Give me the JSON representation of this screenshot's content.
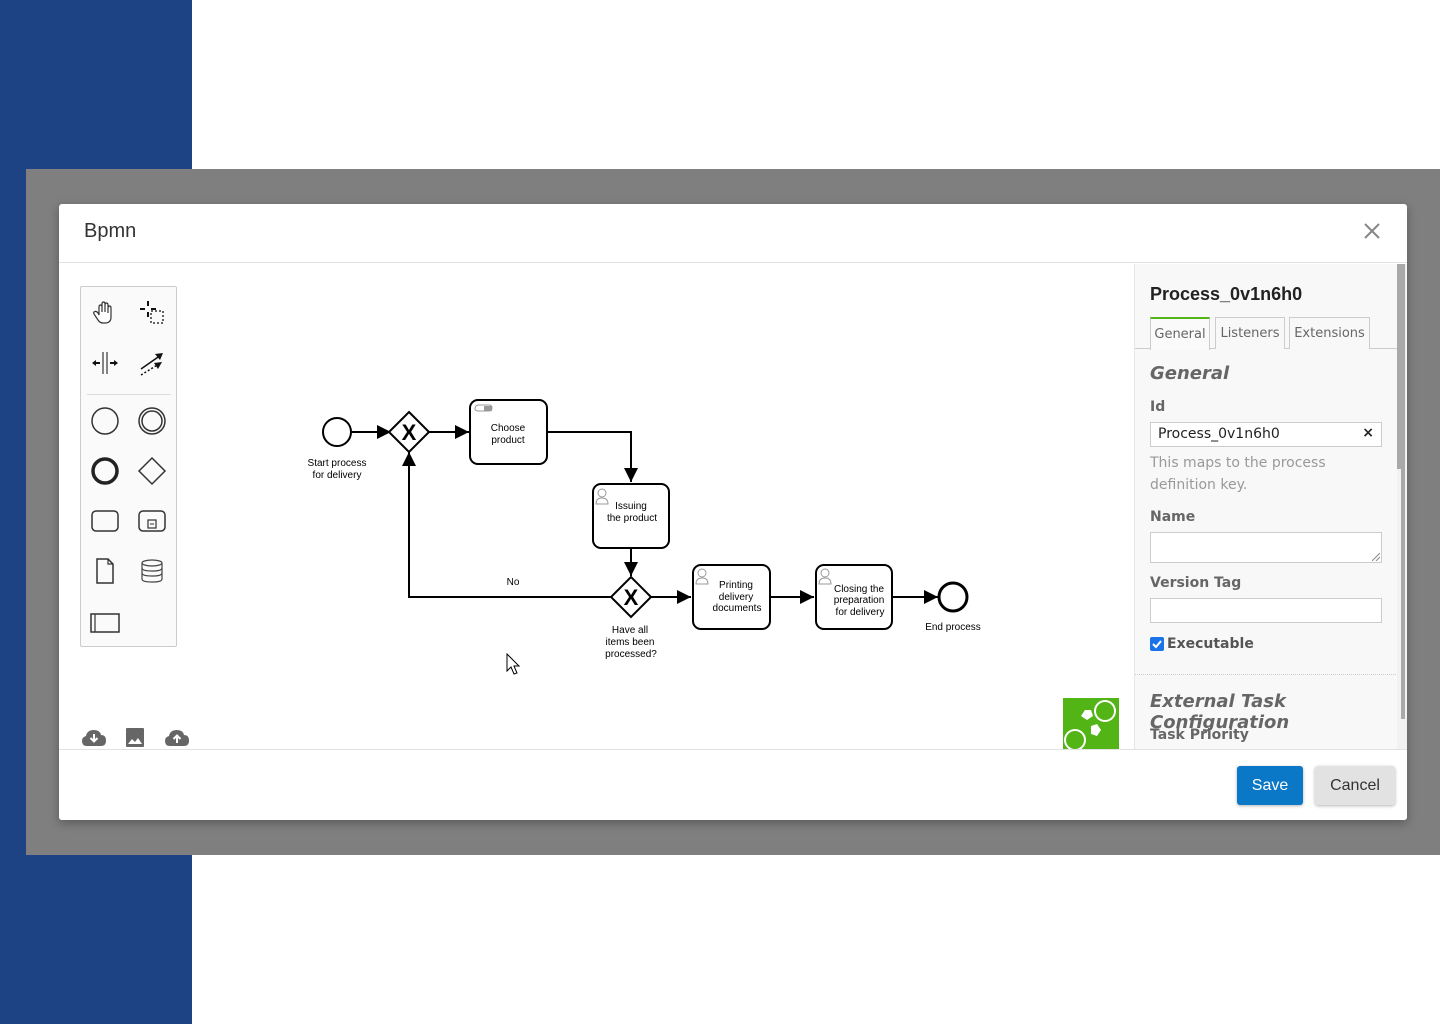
{
  "modal": {
    "title": "Bpmn",
    "close_icon": "close-icon"
  },
  "palette": {
    "tools": [
      {
        "name": "hand-tool",
        "icon": "hand-icon"
      },
      {
        "name": "lasso-tool",
        "icon": "lasso-icon"
      },
      {
        "name": "space-tool",
        "icon": "space-icon"
      },
      {
        "name": "global-connect-tool",
        "icon": "connect-icon"
      },
      {
        "name": "create-start-event",
        "icon": "start-event-icon"
      },
      {
        "name": "create-intermediate-event",
        "icon": "intermediate-event-icon"
      },
      {
        "name": "create-end-event",
        "icon": "end-event-icon"
      },
      {
        "name": "create-gateway",
        "icon": "gateway-icon"
      },
      {
        "name": "create-task",
        "icon": "task-icon"
      },
      {
        "name": "create-subprocess",
        "icon": "subprocess-icon"
      },
      {
        "name": "create-data-object",
        "icon": "data-object-icon"
      },
      {
        "name": "create-data-store",
        "icon": "data-store-icon"
      },
      {
        "name": "create-pool",
        "icon": "pool-icon"
      }
    ]
  },
  "diagram": {
    "start_event": {
      "label_lines": [
        "Start process",
        "for delivery"
      ]
    },
    "gateway_1": {
      "marker": "X"
    },
    "task_choose": {
      "label_lines": [
        "Choose",
        "product"
      ],
      "type": "manual-task"
    },
    "task_issuing": {
      "label_lines": [
        "Issuing",
        "the product"
      ],
      "type": "user-task"
    },
    "gateway_2": {
      "marker": "X",
      "label_lines": [
        "Have all",
        "items been",
        "processed?"
      ]
    },
    "flow_no": {
      "label": "No"
    },
    "task_printing": {
      "label_lines": [
        "Printing",
        "delivery",
        "documents"
      ],
      "type": "user-task"
    },
    "task_closing": {
      "label_lines": [
        "Closing the",
        "preparation",
        "for delivery"
      ],
      "type": "user-task"
    },
    "end_event": {
      "label_lines": [
        "End process"
      ]
    }
  },
  "canvas_actions": [
    {
      "name": "download-diagram-button",
      "icon": "cloud-download-icon"
    },
    {
      "name": "export-image-button",
      "icon": "image-icon"
    },
    {
      "name": "upload-diagram-button",
      "icon": "cloud-upload-icon"
    }
  ],
  "properties": {
    "title": "Process_0v1n6h0",
    "tabs": [
      {
        "label": "General",
        "active": true
      },
      {
        "label": "Listeners",
        "active": false
      },
      {
        "label": "Extensions",
        "active": false
      }
    ],
    "group_general": "General",
    "id_label": "Id",
    "id_value": "Process_0v1n6h0",
    "id_clear": "×",
    "id_hint": "This maps to the process definition key.",
    "name_label": "Name",
    "name_value": "",
    "version_label": "Version Tag",
    "version_value": "",
    "executable_label": "Executable",
    "executable_checked": true,
    "group_external": "External Task Configuration",
    "task_priority_label": "Task Priority"
  },
  "footer": {
    "save_label": "Save",
    "cancel_label": "Cancel"
  },
  "colors": {
    "accent_blue": "#0a78c7",
    "tab_active_green": "#52b415",
    "logo_green": "#52b415",
    "background_blue": "#1e4384"
  }
}
